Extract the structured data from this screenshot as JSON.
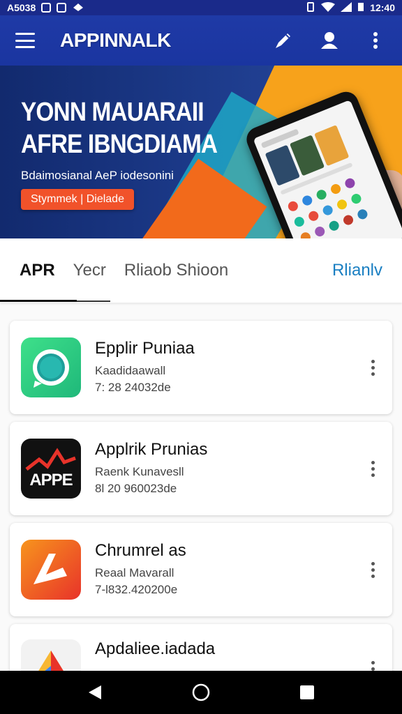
{
  "status_bar": {
    "left_text": "A5038",
    "time": "12:40"
  },
  "app_bar": {
    "title": "APPINNALK"
  },
  "banner": {
    "headline_line1": "YONN MAUARAII",
    "headline_line2": "AFRE IBNGDIAMA",
    "subtitle": "Bdaimosianal AeP iodesonini",
    "cta_label": "Stymmek | Dielade"
  },
  "tabs": [
    {
      "label": "APR"
    },
    {
      "label": "Yecr"
    },
    {
      "label": "Rliaob Shioon"
    },
    {
      "label": "Rlianlv"
    }
  ],
  "apps": [
    {
      "name": "Epplir Puniaa",
      "developer": "Kaadidaawall",
      "meta": "7: 28 24032de",
      "icon": "green-chat-icon"
    },
    {
      "name": "Applrik Prunias",
      "developer": "Raenk Kunavesll",
      "meta": "8l 20 960023de",
      "icon": "appe-logo-icon",
      "icon_text": "APPE"
    },
    {
      "name": "Chrumrel as",
      "developer": "Reaal Mavarall",
      "meta": "7-l832.420200e",
      "icon": "orange-arrow-icon"
    },
    {
      "name": "Apdaliee.iadada",
      "developer": "",
      "meta": "",
      "icon": "colorful-triangle-icon"
    }
  ],
  "colors": {
    "app_bar": "#1f3aa6",
    "accent": "#1a7fc2",
    "cta": "#f1522a"
  }
}
